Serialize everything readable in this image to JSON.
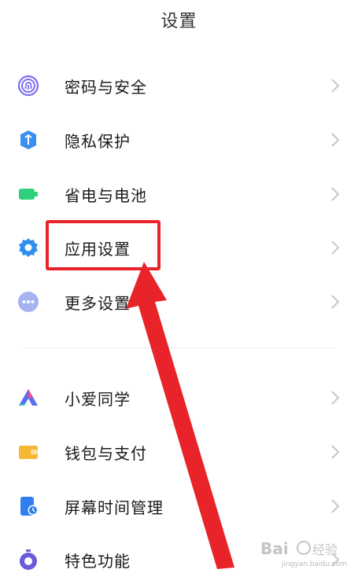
{
  "header": {
    "title": "设置"
  },
  "groups": [
    {
      "items": [
        {
          "label": "密码与安全",
          "icon": "fingerprint-icon",
          "color": "#7b6ef0"
        },
        {
          "label": "隐私保护",
          "icon": "privacy-shield-icon",
          "color": "#3a8ff0"
        },
        {
          "label": "省电与电池",
          "icon": "battery-icon",
          "color": "#2fd07a"
        },
        {
          "label": "应用设置",
          "icon": "gear-icon",
          "color": "#2f8ff0"
        },
        {
          "label": "更多设置",
          "icon": "more-dots-icon",
          "color": "#a7b3f0"
        }
      ]
    },
    {
      "items": [
        {
          "label": "小爱同学",
          "icon": "xiaoai-icon",
          "color": "#5a6df0"
        },
        {
          "label": "钱包与支付",
          "icon": "wallet-icon",
          "color": "#f5b833"
        },
        {
          "label": "屏幕时间管理",
          "icon": "screen-time-icon",
          "color": "#2f7ff0"
        },
        {
          "label": "特色功能",
          "icon": "stopwatch-icon",
          "color": "#6a5cd8"
        }
      ]
    }
  ],
  "annotation": {
    "color": "#e8242a"
  },
  "watermark": {
    "text": "jingyan.baidu.com"
  }
}
